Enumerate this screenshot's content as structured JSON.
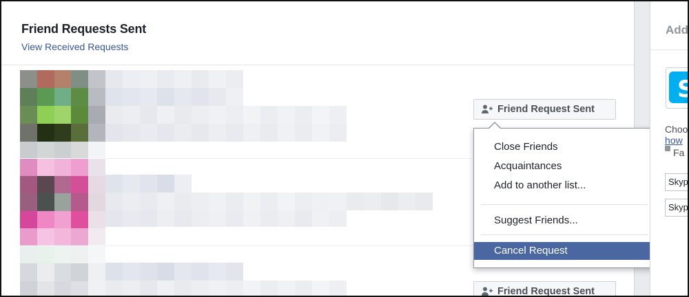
{
  "header": {
    "title": "Friend Requests Sent",
    "view_received_link": "View Received Requests"
  },
  "requests": [
    {
      "button_label": "Friend Request Sent"
    },
    {
      "button_label": "Friend Request Sent"
    }
  ],
  "menu": {
    "items": [
      "Close Friends",
      "Acquaintances",
      "Add to another list...",
      "Suggest Friends...",
      "Cancel Request"
    ],
    "highlighted_item": "Cancel Request"
  },
  "right_column": {
    "title": "Add",
    "app_name": "Skype",
    "description": "Choo",
    "link": "how",
    "privacy": "Fa",
    "input_1": "Skyp",
    "input_2": "Skyp"
  },
  "colors": {
    "link": "#365899",
    "menu_highlight": "#4b67a1",
    "skype": "#00aff0"
  }
}
